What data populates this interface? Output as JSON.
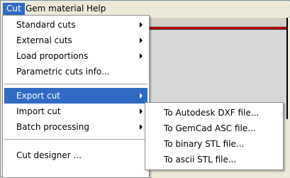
{
  "menubar": {
    "items": [
      {
        "label": "Cut"
      },
      {
        "label": "Gem material"
      },
      {
        "label": "Help"
      }
    ]
  },
  "cut_menu": {
    "items": [
      {
        "label": "Standard cuts"
      },
      {
        "label": "External cuts"
      },
      {
        "label": "Load proportions"
      },
      {
        "label": "Parametric cuts info..."
      },
      {
        "label": "Export cut"
      },
      {
        "label": "Import cut"
      },
      {
        "label": "Batch processing"
      },
      {
        "label": "Cut designer ..."
      }
    ]
  },
  "export_submenu": {
    "items": [
      {
        "label": "To Autodesk DXF file..."
      },
      {
        "label": "To GemCad ASC file..."
      },
      {
        "label": "To binary STL file..."
      },
      {
        "label": "To ascii STL file..."
      }
    ]
  },
  "colors": {
    "highlight": "#316ac5",
    "menu_background": "#ffffff",
    "window_background": "#ece9d8",
    "accent_line": "#b00000"
  }
}
